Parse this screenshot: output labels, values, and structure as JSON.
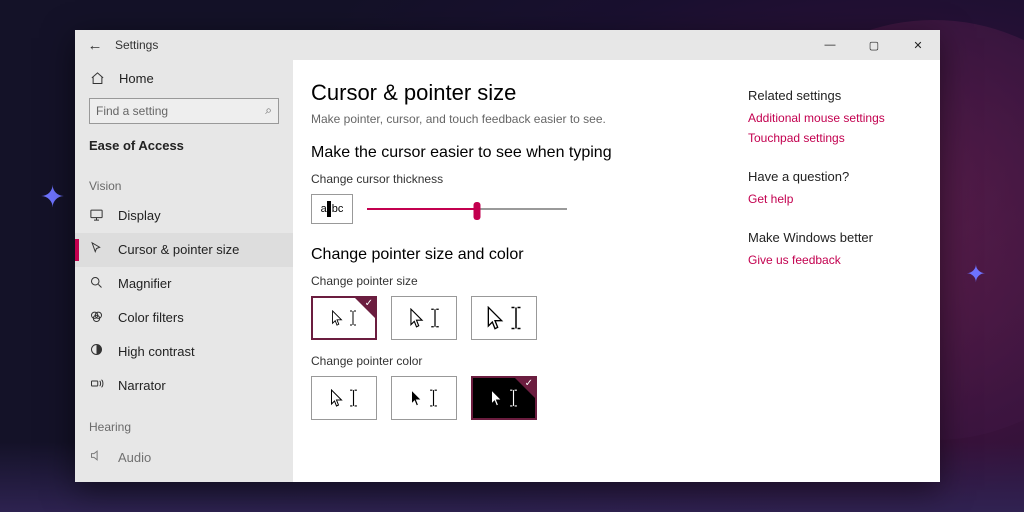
{
  "header": {
    "back_icon": "←",
    "title": "Settings"
  },
  "window_controls": {
    "min": "—",
    "max": "▢",
    "close": "✕"
  },
  "sidebar": {
    "home": "Home",
    "search_placeholder": "Find a setting",
    "search_icon": "⌕",
    "category": "Ease of Access",
    "group_vision": "Vision",
    "items_vision": [
      {
        "label": "Display",
        "icon": "display"
      },
      {
        "label": "Cursor & pointer size",
        "icon": "cursor",
        "active": true
      },
      {
        "label": "Magnifier",
        "icon": "magnifier"
      },
      {
        "label": "Color filters",
        "icon": "colorfilters"
      },
      {
        "label": "High contrast",
        "icon": "highcontrast"
      },
      {
        "label": "Narrator",
        "icon": "narrator"
      }
    ],
    "group_hearing": "Hearing",
    "items_hearing": [
      {
        "label": "Audio",
        "icon": "audio"
      }
    ]
  },
  "page": {
    "title": "Cursor & pointer size",
    "subtitle": "Make pointer, cursor, and touch feedback easier to see.",
    "section_typing": "Make the cursor easier to see when typing",
    "thickness_label": "Change cursor thickness",
    "thickness_preview_text": "bc",
    "slider_percent": 55,
    "section_pointer": "Change pointer size and color",
    "pointer_size_label": "Change pointer size",
    "pointer_size_options": [
      "small",
      "medium",
      "large"
    ],
    "pointer_size_selected": 0,
    "pointer_color_label": "Change pointer color",
    "pointer_color_options": [
      "white",
      "black",
      "inverted"
    ],
    "pointer_color_selected": 2
  },
  "aside": {
    "related_heading": "Related settings",
    "related_links": [
      "Additional mouse settings",
      "Touchpad settings"
    ],
    "question_heading": "Have a question?",
    "question_link": "Get help",
    "feedback_heading": "Make Windows better",
    "feedback_link": "Give us feedback"
  },
  "colors": {
    "accent": "#c3004f"
  }
}
